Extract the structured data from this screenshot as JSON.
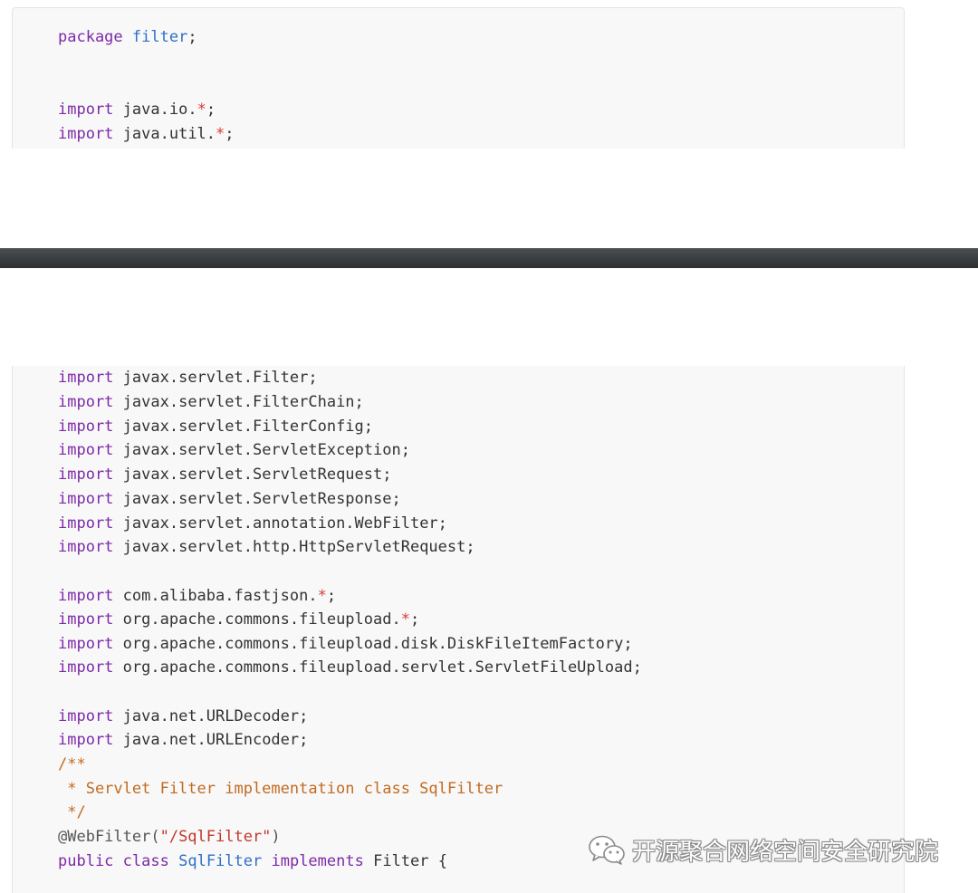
{
  "snippet_top": {
    "line1": {
      "kw": "package",
      "name": "filter",
      "semi": ";"
    },
    "line2": {
      "kw": "import",
      "pkg": "java.io.",
      "star": "*",
      "semi": ";"
    },
    "line3": {
      "kw": "import",
      "pkg": "java.util.",
      "star": "*",
      "semi": ";"
    }
  },
  "snippet_bottom": {
    "imports_servlet": [
      {
        "kw": "import",
        "path": "javax.servlet.Filter;"
      },
      {
        "kw": "import",
        "path": "javax.servlet.FilterChain;"
      },
      {
        "kw": "import",
        "path": "javax.servlet.FilterConfig;"
      },
      {
        "kw": "import",
        "path": "javax.servlet.ServletException;"
      },
      {
        "kw": "import",
        "path": "javax.servlet.ServletRequest;"
      },
      {
        "kw": "import",
        "path": "javax.servlet.ServletResponse;"
      },
      {
        "kw": "import",
        "path": "javax.servlet.annotation.WebFilter;"
      },
      {
        "kw": "import",
        "path": "javax.servlet.http.HttpServletRequest;"
      }
    ],
    "imports_libs": [
      {
        "kw": "import",
        "pkg": "com.alibaba.fastjson.",
        "star": "*",
        "semi": ";"
      },
      {
        "kw": "import",
        "pkg": "org.apache.commons.fileupload.",
        "star": "*",
        "semi": ";"
      },
      {
        "kw": "import",
        "path": "org.apache.commons.fileupload.disk.DiskFileItemFactory;"
      },
      {
        "kw": "import",
        "path": "org.apache.commons.fileupload.servlet.ServletFileUpload;"
      }
    ],
    "imports_net": [
      {
        "kw": "import",
        "path": "java.net.URLDecoder;"
      },
      {
        "kw": "import",
        "path": "java.net.URLEncoder;"
      }
    ],
    "comment": {
      "open": "/**",
      "body": " * Servlet Filter implementation class SqlFilter",
      "close": " */"
    },
    "annotation": {
      "name": "@WebFilter(",
      "value": "\"/SqlFilter\"",
      "close": ")"
    },
    "class_decl": {
      "kw1": "public",
      "kw2": "class",
      "name": "SqlFilter",
      "kw3": "implements",
      "iface": "Filter",
      "brace": "{"
    }
  },
  "watermark": {
    "icon": "wechat-icon",
    "text": "开源聚合网络空间安全研究院"
  },
  "colors": {
    "keyword": "#7d2aa8",
    "type": "#2f6fc6",
    "operator": "#d93b3b",
    "string": "#c0392b",
    "comment": "#c26b20",
    "code_bg": "#f8f8f8",
    "divider": "#393c3e"
  }
}
